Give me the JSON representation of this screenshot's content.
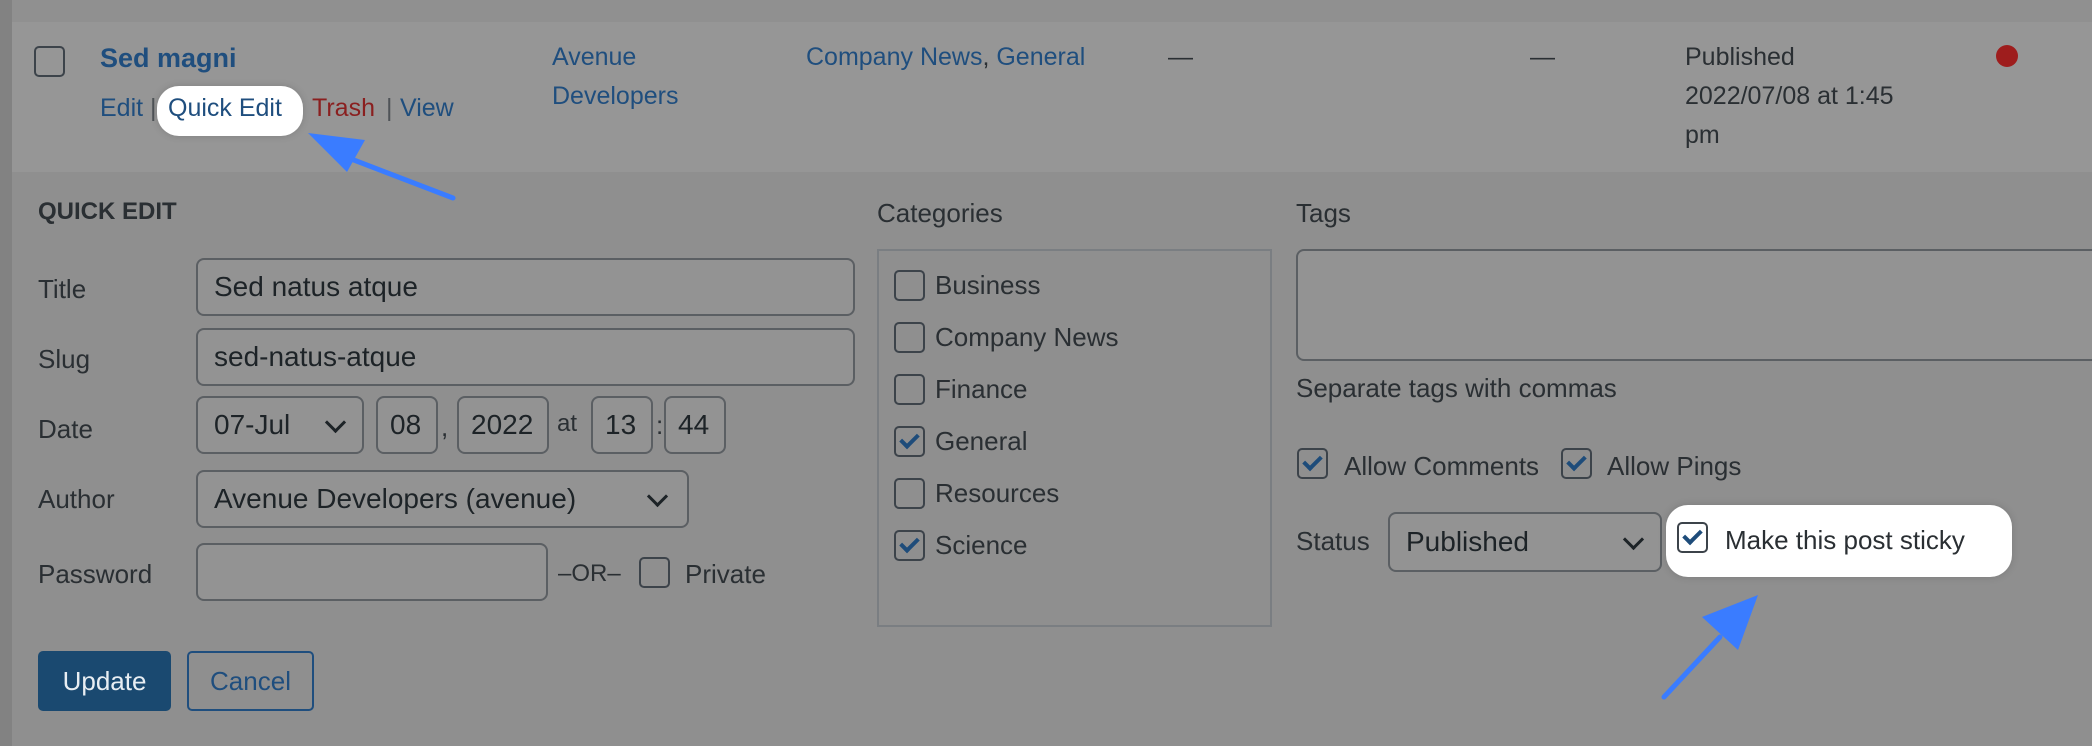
{
  "row": {
    "title": "Sed magni",
    "actions": {
      "edit": "Edit",
      "quick_edit": "Quick Edit",
      "trash": "Trash",
      "view": "View"
    },
    "author_line1": "Avenue",
    "author_line2": "Developers",
    "categories": {
      "first": "Company News",
      "comma": ",",
      "second": "General"
    },
    "tags": "—",
    "comments": "—",
    "date_status": "Published",
    "date_line1": "2022/07/08 at 1:45",
    "date_line2": "pm"
  },
  "quick_edit": {
    "heading": "QUICK EDIT",
    "title_label": "Title",
    "title_value": "Sed natus atque",
    "slug_label": "Slug",
    "slug_value": "sed-natus-atque",
    "date_label": "Date",
    "month": "07-Jul",
    "day": "08",
    "comma": ",",
    "year": "2022",
    "at": "at",
    "hour": "13",
    "colon": ":",
    "minute": "44",
    "author_label": "Author",
    "author_value": "Avenue Developers (avenue)",
    "password_label": "Password",
    "or_text": "–OR–",
    "private_label": "Private",
    "update_button": "Update",
    "cancel_button": "Cancel"
  },
  "categories_box": {
    "heading": "Categories",
    "items": [
      {
        "label": "Business",
        "checked": false
      },
      {
        "label": "Company News",
        "checked": false
      },
      {
        "label": "Finance",
        "checked": false
      },
      {
        "label": "General",
        "checked": true
      },
      {
        "label": "Resources",
        "checked": false
      },
      {
        "label": "Science",
        "checked": true
      }
    ]
  },
  "tags_box": {
    "heading": "Tags",
    "hint": "Separate tags with commas",
    "allow_comments": "Allow Comments",
    "allow_pings": "Allow Pings",
    "status_label": "Status",
    "status_value": "Published",
    "sticky_label": "Make this post sticky"
  },
  "colors": {
    "link": "#1f4e7e",
    "trash": "#8a1f1f",
    "primary_button": "#1a4970",
    "status_dot": "#9e1d1d",
    "arrow": "#3a7cff"
  }
}
